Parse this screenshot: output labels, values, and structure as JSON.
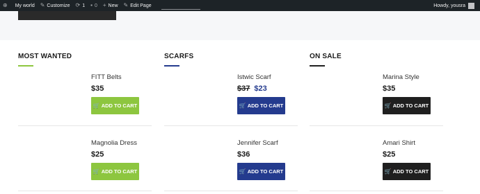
{
  "admin_bar": {
    "site": "My world",
    "customize": "Customize",
    "updates_count": "1",
    "comments_count": "0",
    "new_label": "New",
    "edit_page": "Edit Page",
    "howdy": "Howdy, yousra"
  },
  "colors": {
    "green": "#8dc63f",
    "navy": "#243b8e",
    "black": "#1f1f1f"
  },
  "columns": [
    {
      "title": "MOST WANTED",
      "items": [
        {
          "name": "FITT Belts",
          "price": "$35",
          "button": "ADD TO CART"
        },
        {
          "name": "Magnolia Dress",
          "price": "$25",
          "button": "ADD TO CART"
        }
      ]
    },
    {
      "title": "SCARFS",
      "items": [
        {
          "name": "Istwic Scarf",
          "old_price": "$37",
          "price": "$23",
          "button": "ADD TO CART"
        },
        {
          "name": "Jennifer Scarf",
          "price": "$36",
          "button": "ADD TO CART"
        }
      ]
    },
    {
      "title": "ON SALE",
      "items": [
        {
          "name": "Marina Style",
          "price": "$35",
          "button": "ADD TO CART"
        },
        {
          "name": "Amari Shirt",
          "price": "$25",
          "button": "ADD TO CART"
        }
      ]
    }
  ]
}
